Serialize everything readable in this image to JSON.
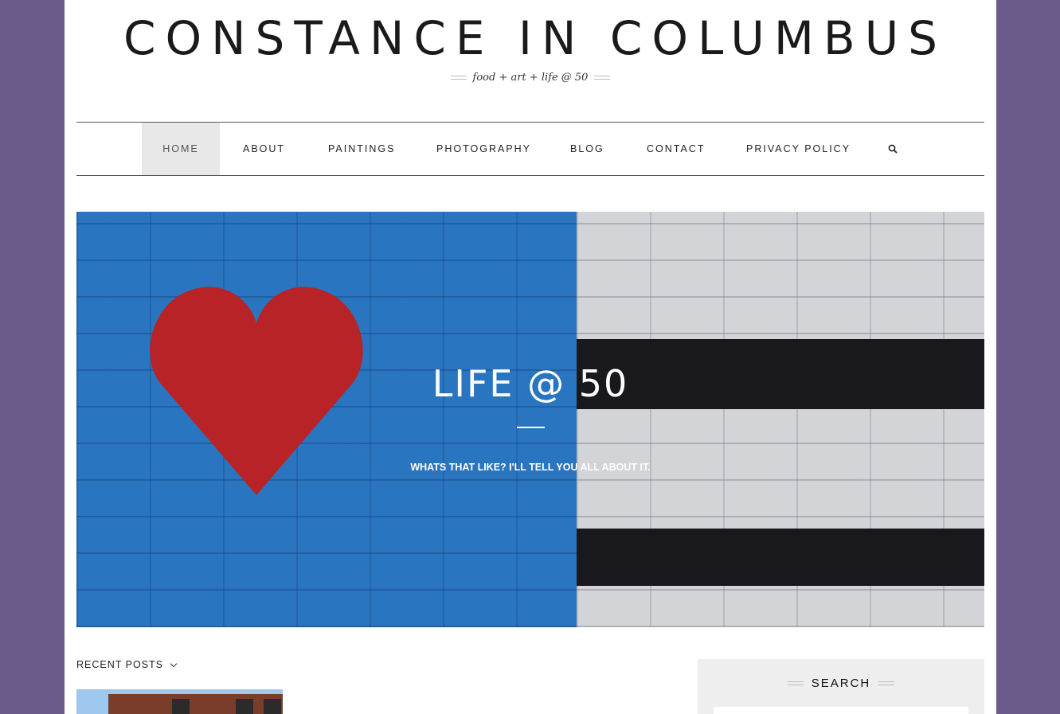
{
  "site": {
    "title": "CONSTANCE IN COLUMBUS",
    "tagline": "food + art + life @ 50"
  },
  "nav": {
    "items": [
      {
        "label": "HOME",
        "active": true
      },
      {
        "label": "ABOUT"
      },
      {
        "label": "PAINTINGS"
      },
      {
        "label": "PHOTOGRAPHY"
      },
      {
        "label": "BLOG"
      },
      {
        "label": "CONTACT"
      },
      {
        "label": "PRIVACY POLICY"
      }
    ],
    "search_icon": "search-icon"
  },
  "hero": {
    "title": "LIFE @ 50",
    "subtitle": "WHATS THAT LIKE? I'LL TELL YOU ALL ABOUT IT."
  },
  "recent": {
    "label": "RECENT POSTS"
  },
  "sidebar": {
    "search_title": "SEARCH"
  },
  "colors": {
    "background": "#6b5b8a",
    "heart": "#c8272b",
    "wall_blue": "#2e7fd0"
  }
}
